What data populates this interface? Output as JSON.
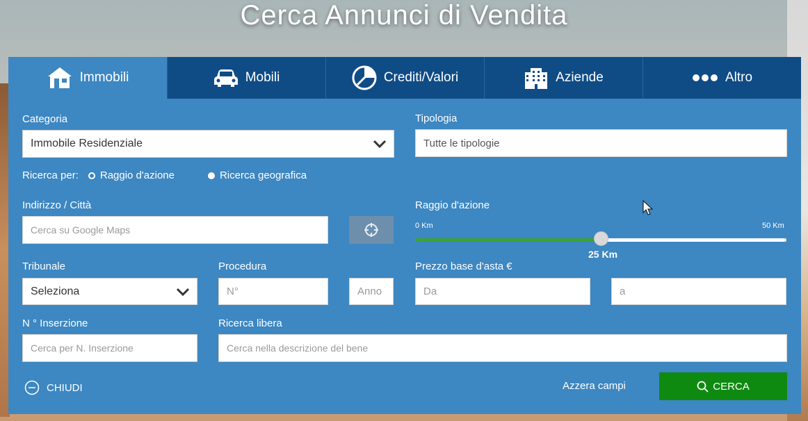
{
  "page_title": "Cerca Annunci di Vendita",
  "tabs": [
    {
      "label": "Immobili",
      "icon": "house-icon",
      "active": true
    },
    {
      "label": "Mobili",
      "icon": "car-icon",
      "active": false
    },
    {
      "label": "Crediti/Valori",
      "icon": "credits-icon",
      "active": false
    },
    {
      "label": "Aziende",
      "icon": "building-icon",
      "active": false
    },
    {
      "label": "Altro",
      "icon": "dots-icon",
      "active": false
    }
  ],
  "form": {
    "categoria": {
      "label": "Categoria",
      "value": "Immobile Residenziale"
    },
    "tipologia": {
      "label": "Tipologia",
      "placeholder": "Tutte le tipologie"
    },
    "ricerca_per": {
      "label": "Ricerca per:",
      "options": [
        "Raggio d'azione",
        "Ricerca geografica"
      ],
      "selected": "Raggio d'azione"
    },
    "indirizzo": {
      "label": "Indirizzo / Città",
      "placeholder": "Cerca su Google Maps"
    },
    "raggio": {
      "label": "Raggio d'azione",
      "min_label": "0 Km",
      "max_label": "50 Km",
      "value_label": "25 Km",
      "value_fraction": 0.5
    },
    "tribunale": {
      "label": "Tribunale",
      "value": "Seleziona"
    },
    "procedura": {
      "label": "Procedura",
      "numero_placeholder": "N°",
      "anno_placeholder": "Anno"
    },
    "prezzo": {
      "label": "Prezzo base d'asta €",
      "da_placeholder": "Da",
      "a_placeholder": "a"
    },
    "inserzione": {
      "label": "N ° Inserzione",
      "placeholder": "Cerca per N. Inserzione"
    },
    "ricerca_libera": {
      "label": "Ricerca libera",
      "placeholder": "Cerca nella descrizione del bene"
    }
  },
  "actions": {
    "close_label": "CHIUDI",
    "reset_label": "Azzera campi",
    "search_label": "CERCA"
  },
  "colors": {
    "panel": "#3d87c2",
    "tab_dark": "#0f4c86",
    "search_green": "#0f8a10",
    "slider_green": "#3aa236"
  }
}
